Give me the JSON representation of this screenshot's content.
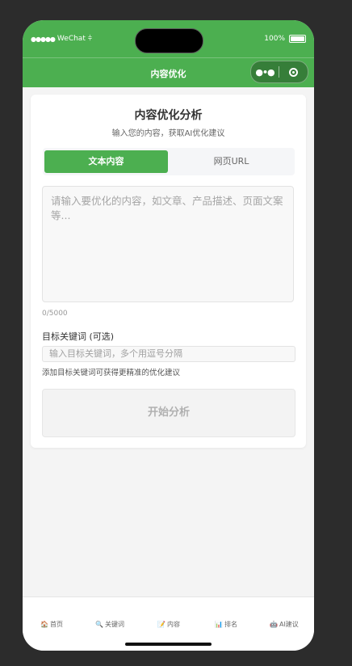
{
  "status_bar": {
    "carrier": "WeChat",
    "battery": "100%"
  },
  "nav": {
    "title": "内容优化"
  },
  "card": {
    "title": "内容优化分析",
    "subtitle": "输入您的内容，获取AI优化建议",
    "tabs": [
      {
        "label": "文本内容",
        "active": true
      },
      {
        "label": "网页URL",
        "active": false
      }
    ],
    "content_placeholder": "请输入要优化的内容，如文章、产品描述、页面文案等...",
    "char_count": "0/5000",
    "keyword_label": "目标关键词 (可选)",
    "keyword_placeholder": "输入目标关键词，多个用逗号分隔",
    "keyword_hint": "添加目标关键词可获得更精准的优化建议",
    "start_button": "开始分析"
  },
  "tabbar": [
    {
      "label": "首页",
      "icon": "🏠"
    },
    {
      "label": "关键词",
      "icon": "🔍"
    },
    {
      "label": "内容",
      "icon": "📝"
    },
    {
      "label": "排名",
      "icon": "📊"
    },
    {
      "label": "AI建议",
      "icon": "🤖"
    }
  ],
  "colors": {
    "accent": "#4caf50"
  }
}
